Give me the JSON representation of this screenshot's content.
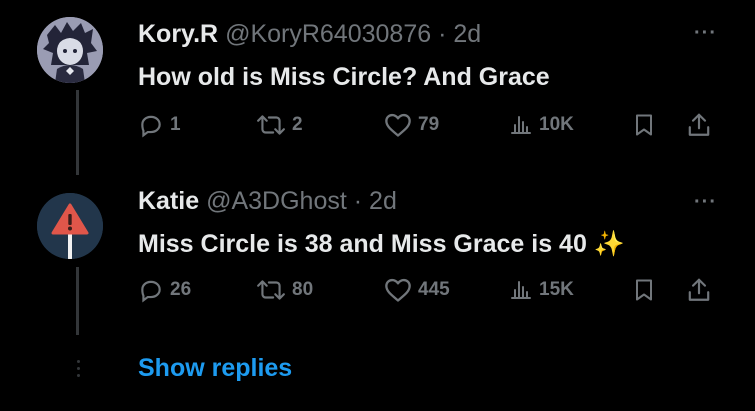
{
  "tweets": [
    {
      "name": "Kory.R",
      "handle": "@KoryR64030876",
      "separator": "·",
      "time": "2d",
      "text": "How old is Miss Circle? And Grace",
      "replies": "1",
      "retweets": "2",
      "likes": "79",
      "views": "10K"
    },
    {
      "name": "Katie",
      "handle": "@A3DGhost",
      "separator": "·",
      "time": "2d",
      "text": "Miss Circle is 38 and Miss Grace is 40",
      "emoji": "✨",
      "replies": "26",
      "retweets": "80",
      "likes": "445",
      "views": "15K"
    }
  ],
  "more_label": "···",
  "show_replies": "Show replies",
  "colors": {
    "background": "#000000",
    "text": "#e7e9ea",
    "muted": "#71767b",
    "accent": "#1d9bf0",
    "warning": "#e0564a"
  },
  "icons": [
    "reply-icon",
    "retweet-icon",
    "like-icon",
    "views-icon",
    "bookmark-icon",
    "share-icon",
    "more-icon"
  ]
}
